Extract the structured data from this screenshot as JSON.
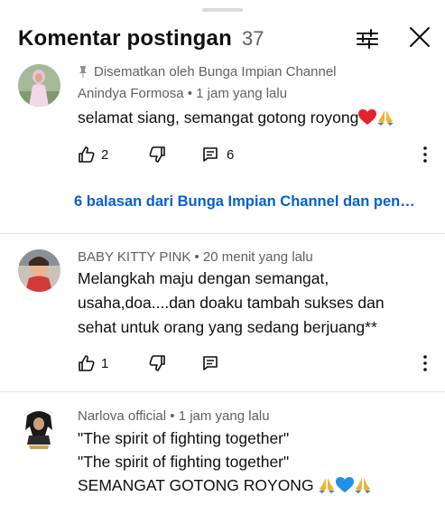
{
  "header": {
    "title": "Komentar postingan",
    "count": "37"
  },
  "comments": [
    {
      "pinned_label": "Disematkan oleh Bunga Impian Channel",
      "author": "Anindya Formosa",
      "time": "1 jam yang lalu",
      "lines": [
        "selamat siang, semangat gotong royong"
      ],
      "emojis": [
        "red-heart",
        "folded-hands"
      ],
      "likes": "2",
      "replies_count": "6",
      "replies_link": "6 balasan dari Bunga Impian Channel dan pen…"
    },
    {
      "author": "BABY KITTY PINK",
      "time": "20 menit yang lalu",
      "lines": [
        "Melangkah maju dengan semangat,",
        "usaha,doa....dan doaku tambah sukses dan",
        "sehat untuk orang yang sedang berjuang**"
      ],
      "likes": "1"
    },
    {
      "author": "Narlova official",
      "time": "1 jam yang lalu",
      "lines": [
        "\"The spirit of fighting together\"",
        "\"The spirit of fighting together\"",
        "SEMANGAT GOTONG ROYONG "
      ],
      "emojis": [
        "folded-hands",
        "blue-heart",
        "folded-hands"
      ]
    }
  ],
  "meta_separator": " • ",
  "colors": {
    "link": "#065fd4",
    "secondary_text": "#606060",
    "divider": "#e5e5e5"
  },
  "icons": [
    "sliders-icon",
    "close-icon",
    "pin-icon",
    "thumbs-up-icon",
    "thumbs-down-icon",
    "reply-icon",
    "more-vertical-icon"
  ]
}
